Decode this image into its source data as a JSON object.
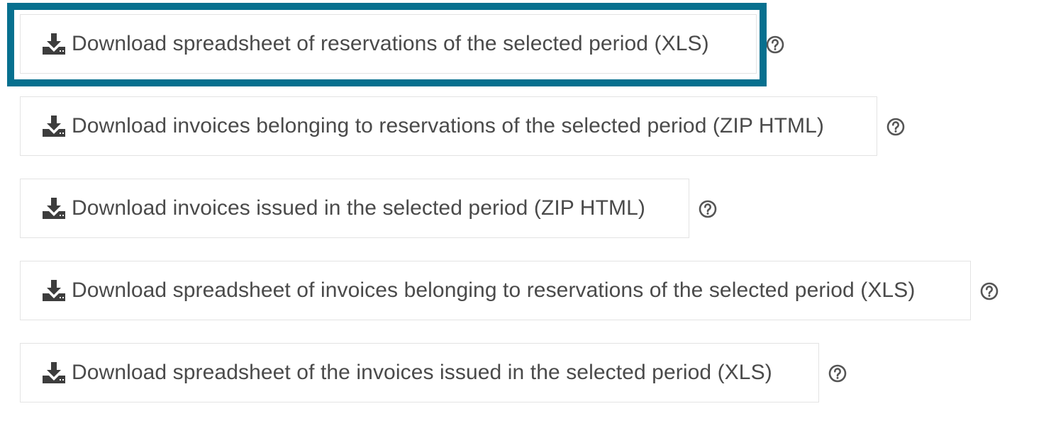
{
  "colors": {
    "focus_ring": "#07708f",
    "text": "#4a4a4a",
    "icon": "#3d3d3d",
    "border": "#e3e3e3",
    "help_icon": "#555555"
  },
  "icons": {
    "download": "download-icon",
    "help": "question-circle-icon"
  },
  "buttons": [
    {
      "label": "Download spreadsheet of reservations of the selected period (XLS)",
      "focused": true
    },
    {
      "label": "Download invoices belonging to reservations of the selected period (ZIP HTML)",
      "focused": false
    },
    {
      "label": "Download invoices issued in the selected period (ZIP HTML)",
      "focused": false
    },
    {
      "label": "Download spreadsheet of invoices belonging to reservations of the selected period (XLS)",
      "focused": false
    },
    {
      "label": "Download spreadsheet of the invoices issued in the selected period (XLS)",
      "focused": false
    }
  ]
}
